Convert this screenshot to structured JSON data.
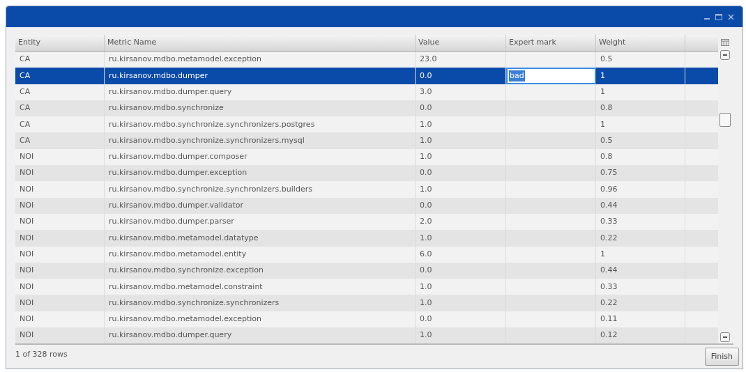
{
  "table": {
    "columns": [
      "Entity",
      "Metric Name",
      "Value",
      "Expert mark",
      "Weight"
    ],
    "rows": [
      {
        "entity": "CA",
        "metric": "ru.kirsanov.mdbo.metamodel.exception",
        "value": "23.0",
        "weight": "0.5",
        "selected": false
      },
      {
        "entity": "CA",
        "metric": "ru.kirsanov.mdbo.dumper",
        "value": "0.0",
        "expert_mark": "bad",
        "weight": "1",
        "selected": true
      },
      {
        "entity": "CA",
        "metric": "ru.kirsanov.mdbo.dumper.query",
        "value": "3.0",
        "weight": "1",
        "selected": false
      },
      {
        "entity": "CA",
        "metric": "ru.kirsanov.mdbo.synchronize",
        "value": "0.0",
        "weight": "0.8",
        "selected": false
      },
      {
        "entity": "CA",
        "metric": "ru.kirsanov.mdbo.synchronize.synchronizers.postgres",
        "value": "1.0",
        "weight": "1",
        "selected": false
      },
      {
        "entity": "CA",
        "metric": "ru.kirsanov.mdbo.synchronize.synchronizers.mysql",
        "value": "1.0",
        "weight": "0.5",
        "selected": false
      },
      {
        "entity": "NOI",
        "metric": "ru.kirsanov.mdbo.dumper.composer",
        "value": "1.0",
        "weight": "0.8",
        "selected": false
      },
      {
        "entity": "NOI",
        "metric": "ru.kirsanov.mdbo.dumper.exception",
        "value": "0.0",
        "weight": "0.75",
        "selected": false
      },
      {
        "entity": "NOI",
        "metric": "ru.kirsanov.mdbo.synchronize.synchronizers.builders",
        "value": "1.0",
        "weight": "0.96",
        "selected": false
      },
      {
        "entity": "NOI",
        "metric": "ru.kirsanov.mdbo.dumper.validator",
        "value": "0.0",
        "weight": "0.44",
        "selected": false
      },
      {
        "entity": "NOI",
        "metric": "ru.kirsanov.mdbo.dumper.parser",
        "value": "2.0",
        "weight": "0.33",
        "selected": false
      },
      {
        "entity": "NOI",
        "metric": "ru.kirsanov.mdbo.metamodel.datatype",
        "value": "1.0",
        "weight": "0.22",
        "selected": false
      },
      {
        "entity": "NOI",
        "metric": "ru.kirsanov.mdbo.metamodel.entity",
        "value": "6.0",
        "weight": "1",
        "selected": false
      },
      {
        "entity": "NOI",
        "metric": "ru.kirsanov.mdbo.synchronize.exception",
        "value": "0.0",
        "weight": "0.44",
        "selected": false
      },
      {
        "entity": "NOI",
        "metric": "ru.kirsanov.mdbo.metamodel.constraint",
        "value": "1.0",
        "weight": "0.33",
        "selected": false
      },
      {
        "entity": "NOI",
        "metric": "ru.kirsanov.mdbo.synchronize.synchronizers",
        "value": "1.0",
        "weight": "0.22",
        "selected": false
      },
      {
        "entity": "NOI",
        "metric": "ru.kirsanov.mdbo.metamodel.exception",
        "value": "0.0",
        "weight": "0.11",
        "selected": false
      },
      {
        "entity": "NOI",
        "metric": "ru.kirsanov.mdbo.dumper.query",
        "value": "1.0",
        "weight": "0.12",
        "selected": false
      }
    ]
  },
  "status": "1 of 328 rows",
  "buttons": [
    "Finish"
  ]
}
